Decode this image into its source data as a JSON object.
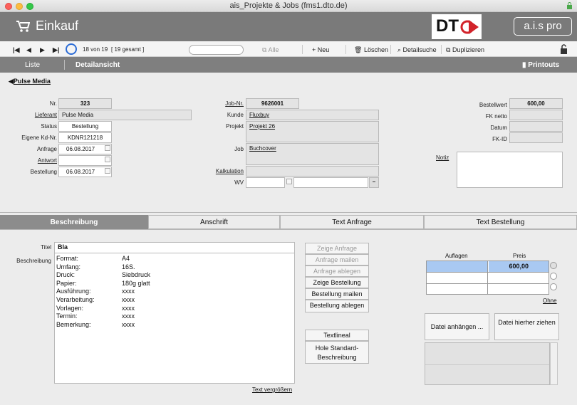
{
  "window": {
    "title": "ais_Projekte & Jobs (fms1.dto.de)"
  },
  "header": {
    "title": "Einkauf",
    "logo_text": "DT",
    "brand": "a.i.s pro"
  },
  "toolbar": {
    "record_info": "18 von 19",
    "total": "[ 19 gesamt ]",
    "search_placeholder": "",
    "all": "Alle",
    "new": "Neu",
    "delete": "Löschen",
    "detail_search": "Detailsuche",
    "duplicate": "Duplizieren"
  },
  "nav": {
    "list": "Liste",
    "detail": "Detailansicht",
    "printouts": "Printouts"
  },
  "breadcrumb": "Pulse Media",
  "left": {
    "nr_label": "Nr.",
    "nr": "323",
    "supplier_label": "Lieferant",
    "supplier": "Pulse Media",
    "status_label": "Status",
    "status": "Bestellung",
    "own_cust_label": "Eigene Kd-Nr.",
    "own_cust": "KDNR121218",
    "request_label": "Anfrage",
    "request": "06.08.2017",
    "answer_label": "Antwort",
    "answer": "",
    "order_label": "Bestellung",
    "order": "06.08.2017"
  },
  "middle": {
    "job_nr_label": "Job-Nr.",
    "job_nr": "9626001",
    "customer_label": "Kunde",
    "customer": "Fluxbuy",
    "project_label": "Projekt",
    "project": "Projekt 26",
    "job_label": "Job",
    "job": "Buchcover",
    "calc_label": "Kalkulation",
    "calc": "",
    "wv_label": "WV",
    "wv": "",
    "wv_note": "",
    "minus": "–"
  },
  "right": {
    "order_value_label": "Bestellwert",
    "order_value": "600,00",
    "fk_net_label": "FK netto",
    "fk_net": "",
    "date_label": "Datum",
    "date": "",
    "fk_id_label": "FK-ID",
    "fk_id": "",
    "note_label": "Notiz",
    "note": ""
  },
  "tabs": [
    "Beschreibung",
    "Anschrift",
    "Text Anfrage",
    "Text Bestellung"
  ],
  "desc": {
    "title_label": "Titel",
    "title": "Bla",
    "desc_label": "Beschreibung",
    "rows": [
      {
        "k": "Format:",
        "v": "A4"
      },
      {
        "k": "Umfang:",
        "v": "16S."
      },
      {
        "k": "Druck:",
        "v": "Siebdruck"
      },
      {
        "k": "Papier:",
        "v": "180g glatt"
      },
      {
        "k": "Ausführung:",
        "v": "xxxx"
      },
      {
        "k": "Verarbeitung:",
        "v": "xxxx"
      },
      {
        "k": "Vorlagen:",
        "v": "xxxx"
      },
      {
        "k": "Termin:",
        "v": "xxxx"
      },
      {
        "k": "Bemerkung:",
        "v": "xxxx"
      }
    ],
    "enlarge": "Text vergrößern"
  },
  "buttons": {
    "show_request": "Zeige Anfrage",
    "mail_request": "Anfrage mailen",
    "file_request": "Anfrage ablegen",
    "show_order": "Zeige Bestellung",
    "mail_order": "Bestellung mailen",
    "file_order": "Bestellung ablegen",
    "text_ruler": "Textlineal",
    "std_desc": "Hole Standard-Beschreibung"
  },
  "quant": {
    "col1": "Auflagen",
    "col2": "Preis",
    "rows": [
      {
        "a": "",
        "p": "600,00"
      },
      {
        "a": "",
        "p": ""
      },
      {
        "a": "",
        "p": ""
      }
    ],
    "none": "Ohne"
  },
  "files": {
    "attach": "Datei anhängen ...",
    "drag": "Datei hierher ziehen"
  }
}
